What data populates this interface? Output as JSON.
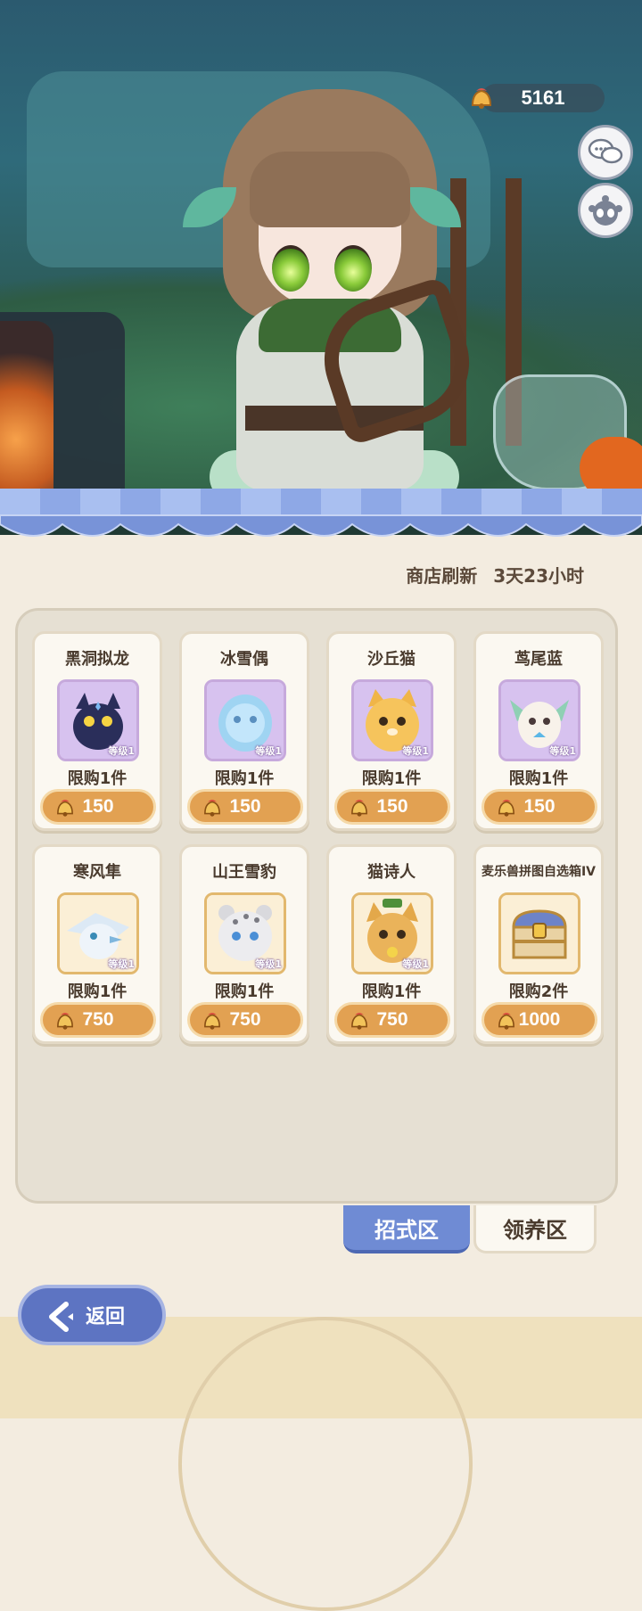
{
  "header": {
    "currency_value": "5161"
  },
  "shop": {
    "refresh_label": "商店刷新",
    "refresh_time": "3天23小时"
  },
  "items": [
    {
      "name": "黑洞拟龙",
      "badge": "等级1",
      "limit": "限购1件",
      "price": "150"
    },
    {
      "name": "冰雪偶",
      "badge": "等级1",
      "limit": "限购1件",
      "price": "150"
    },
    {
      "name": "沙丘猫",
      "badge": "等级1",
      "limit": "限购1件",
      "price": "150"
    },
    {
      "name": "茑尾蓝",
      "badge": "等级1",
      "limit": "限购1件",
      "price": "150"
    },
    {
      "name": "寒风隼",
      "badge": "等级1",
      "limit": "限购1件",
      "price": "750"
    },
    {
      "name": "山王雪豹",
      "badge": "等级1",
      "limit": "限购1件",
      "price": "750"
    },
    {
      "name": "猫诗人",
      "badge": "等级1",
      "limit": "限购1件",
      "price": "750"
    },
    {
      "name": "麦乐兽拼图自选箱IV",
      "limit": "限购2件",
      "price": "1000"
    }
  ],
  "tabs": [
    {
      "label": "招式区",
      "active": true
    },
    {
      "label": "领养区",
      "active": false
    }
  ],
  "back_label": "返回",
  "colors": {
    "accent_blue": "#6f8bd4",
    "price_orange": "#e2a152",
    "panel_bg": "#e6e0d3"
  }
}
